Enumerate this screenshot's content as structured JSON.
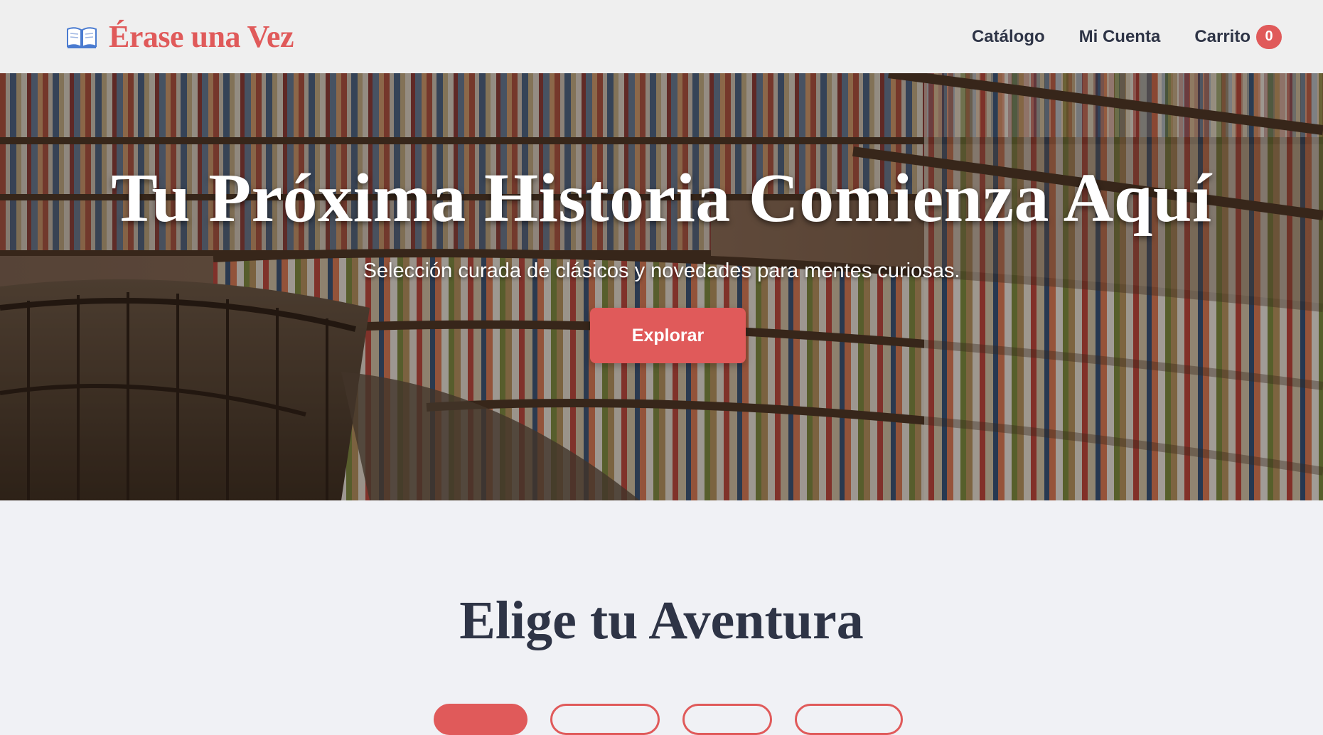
{
  "header": {
    "logo_text": "Érase una Vez",
    "nav": {
      "catalog": "Catálogo",
      "account": "Mi Cuenta",
      "cart": "Carrito",
      "cart_count": "0"
    }
  },
  "hero": {
    "title": "Tu Próxima Historia Comienza Aquí",
    "subtitle": "Selección curada de clásicos y novedades para mentes curiosas.",
    "button": "Explorar"
  },
  "section": {
    "title": "Elige tu Aventura",
    "filters_active_index": 0
  },
  "colors": {
    "accent": "#e05a5a",
    "text_dark": "#2e3446",
    "page_bg": "#f0f1f5",
    "header_bg": "#efefef"
  },
  "icons": {
    "logo": "open-book-icon"
  }
}
